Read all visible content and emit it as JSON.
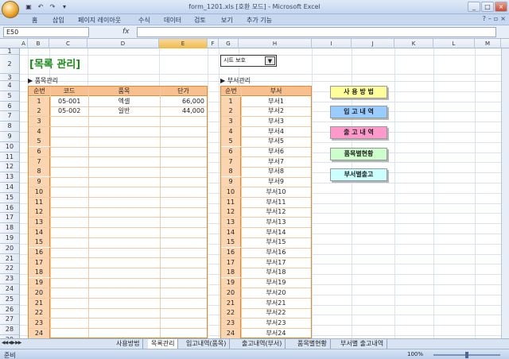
{
  "window": {
    "title": "form_1201.xls  [호환 모드] - Microsoft Excel",
    "controls": [
      "_",
      "□",
      "×"
    ]
  },
  "ribbon": {
    "tabs": [
      "홈",
      "삽입",
      "페이지 레이아웃",
      "수식",
      "데이터",
      "검토",
      "보기",
      "추가 기능"
    ]
  },
  "formula_bar": {
    "name_box": "E50",
    "fx": "fx",
    "value": ""
  },
  "columns": [
    "A",
    "B",
    "C",
    "D",
    "E",
    "F",
    "G",
    "H",
    "I",
    "J",
    "K",
    "L",
    "M"
  ],
  "selected_column": "E",
  "rows": [
    "1",
    "2",
    "3",
    "4",
    "5",
    "6",
    "7",
    "8",
    "9",
    "10",
    "11",
    "12",
    "13",
    "14",
    "15",
    "16",
    "17",
    "18",
    "19",
    "20",
    "21",
    "22",
    "23",
    "24",
    "25",
    "26",
    "27",
    "28",
    "29"
  ],
  "sheet": {
    "title": "[목록 관리]",
    "sheet_protect": "시트 보호",
    "item_section": "▶ 품목관리",
    "dept_section": "▶ 부서관리"
  },
  "item_table": {
    "headers": [
      "순번",
      "코드",
      "품목",
      "단가"
    ],
    "rows": [
      {
        "seq": "1",
        "code": "05-001",
        "item": "엑셀",
        "price": "66,000"
      },
      {
        "seq": "2",
        "code": "05-002",
        "item": "일반",
        "price": "44,000"
      },
      {
        "seq": "3",
        "code": "",
        "item": "",
        "price": ""
      },
      {
        "seq": "4",
        "code": "",
        "item": "",
        "price": ""
      },
      {
        "seq": "5",
        "code": "",
        "item": "",
        "price": ""
      },
      {
        "seq": "6",
        "code": "",
        "item": "",
        "price": ""
      },
      {
        "seq": "7",
        "code": "",
        "item": "",
        "price": ""
      },
      {
        "seq": "8",
        "code": "",
        "item": "",
        "price": ""
      },
      {
        "seq": "9",
        "code": "",
        "item": "",
        "price": ""
      },
      {
        "seq": "10",
        "code": "",
        "item": "",
        "price": ""
      },
      {
        "seq": "11",
        "code": "",
        "item": "",
        "price": ""
      },
      {
        "seq": "12",
        "code": "",
        "item": "",
        "price": ""
      },
      {
        "seq": "13",
        "code": "",
        "item": "",
        "price": ""
      },
      {
        "seq": "14",
        "code": "",
        "item": "",
        "price": ""
      },
      {
        "seq": "15",
        "code": "",
        "item": "",
        "price": ""
      },
      {
        "seq": "16",
        "code": "",
        "item": "",
        "price": ""
      },
      {
        "seq": "17",
        "code": "",
        "item": "",
        "price": ""
      },
      {
        "seq": "18",
        "code": "",
        "item": "",
        "price": ""
      },
      {
        "seq": "19",
        "code": "",
        "item": "",
        "price": ""
      },
      {
        "seq": "20",
        "code": "",
        "item": "",
        "price": ""
      },
      {
        "seq": "21",
        "code": "",
        "item": "",
        "price": ""
      },
      {
        "seq": "22",
        "code": "",
        "item": "",
        "price": ""
      },
      {
        "seq": "23",
        "code": "",
        "item": "",
        "price": ""
      },
      {
        "seq": "24",
        "code": "",
        "item": "",
        "price": ""
      }
    ]
  },
  "dept_table": {
    "headers": [
      "순번",
      "부서"
    ],
    "rows": [
      {
        "seq": "1",
        "dept": "부서1"
      },
      {
        "seq": "2",
        "dept": "부서2"
      },
      {
        "seq": "3",
        "dept": "부서3"
      },
      {
        "seq": "4",
        "dept": "부서4"
      },
      {
        "seq": "5",
        "dept": "부서5"
      },
      {
        "seq": "6",
        "dept": "부서6"
      },
      {
        "seq": "7",
        "dept": "부서7"
      },
      {
        "seq": "8",
        "dept": "부서8"
      },
      {
        "seq": "9",
        "dept": "부서9"
      },
      {
        "seq": "10",
        "dept": "부서10"
      },
      {
        "seq": "11",
        "dept": "부서11"
      },
      {
        "seq": "12",
        "dept": "부서12"
      },
      {
        "seq": "13",
        "dept": "부서13"
      },
      {
        "seq": "14",
        "dept": "부서14"
      },
      {
        "seq": "15",
        "dept": "부서15"
      },
      {
        "seq": "16",
        "dept": "부서16"
      },
      {
        "seq": "17",
        "dept": "부서17"
      },
      {
        "seq": "18",
        "dept": "부서18"
      },
      {
        "seq": "19",
        "dept": "부서19"
      },
      {
        "seq": "20",
        "dept": "부서20"
      },
      {
        "seq": "21",
        "dept": "부서21"
      },
      {
        "seq": "22",
        "dept": "부서22"
      },
      {
        "seq": "23",
        "dept": "부서23"
      },
      {
        "seq": "24",
        "dept": "부서24"
      }
    ]
  },
  "nav_buttons": [
    {
      "label": "사 용 방 법",
      "color": "#ffff99"
    },
    {
      "label": "입 고 내 역",
      "color": "#99ccff"
    },
    {
      "label": "출 고 내 역",
      "color": "#ff99cc"
    },
    {
      "label": "품목별현황",
      "color": "#ccffcc"
    },
    {
      "label": "부서별출고",
      "color": "#ccffff"
    }
  ],
  "sheet_tabs": [
    {
      "label": "사용방법",
      "active": false
    },
    {
      "label": "목록관리",
      "active": true
    },
    {
      "label": "입고내역(품목)",
      "active": false
    },
    {
      "label": "출고내역(부서)",
      "active": false
    },
    {
      "label": "품목별현황",
      "active": false
    },
    {
      "label": "부서별 출고내역",
      "active": false
    }
  ],
  "status": {
    "ready": "준비",
    "zoom": "100%"
  },
  "colors": {
    "accent_orange": "#e08b2c",
    "header_fill": "#f8c08e",
    "title_green": "#1a8a1a"
  }
}
